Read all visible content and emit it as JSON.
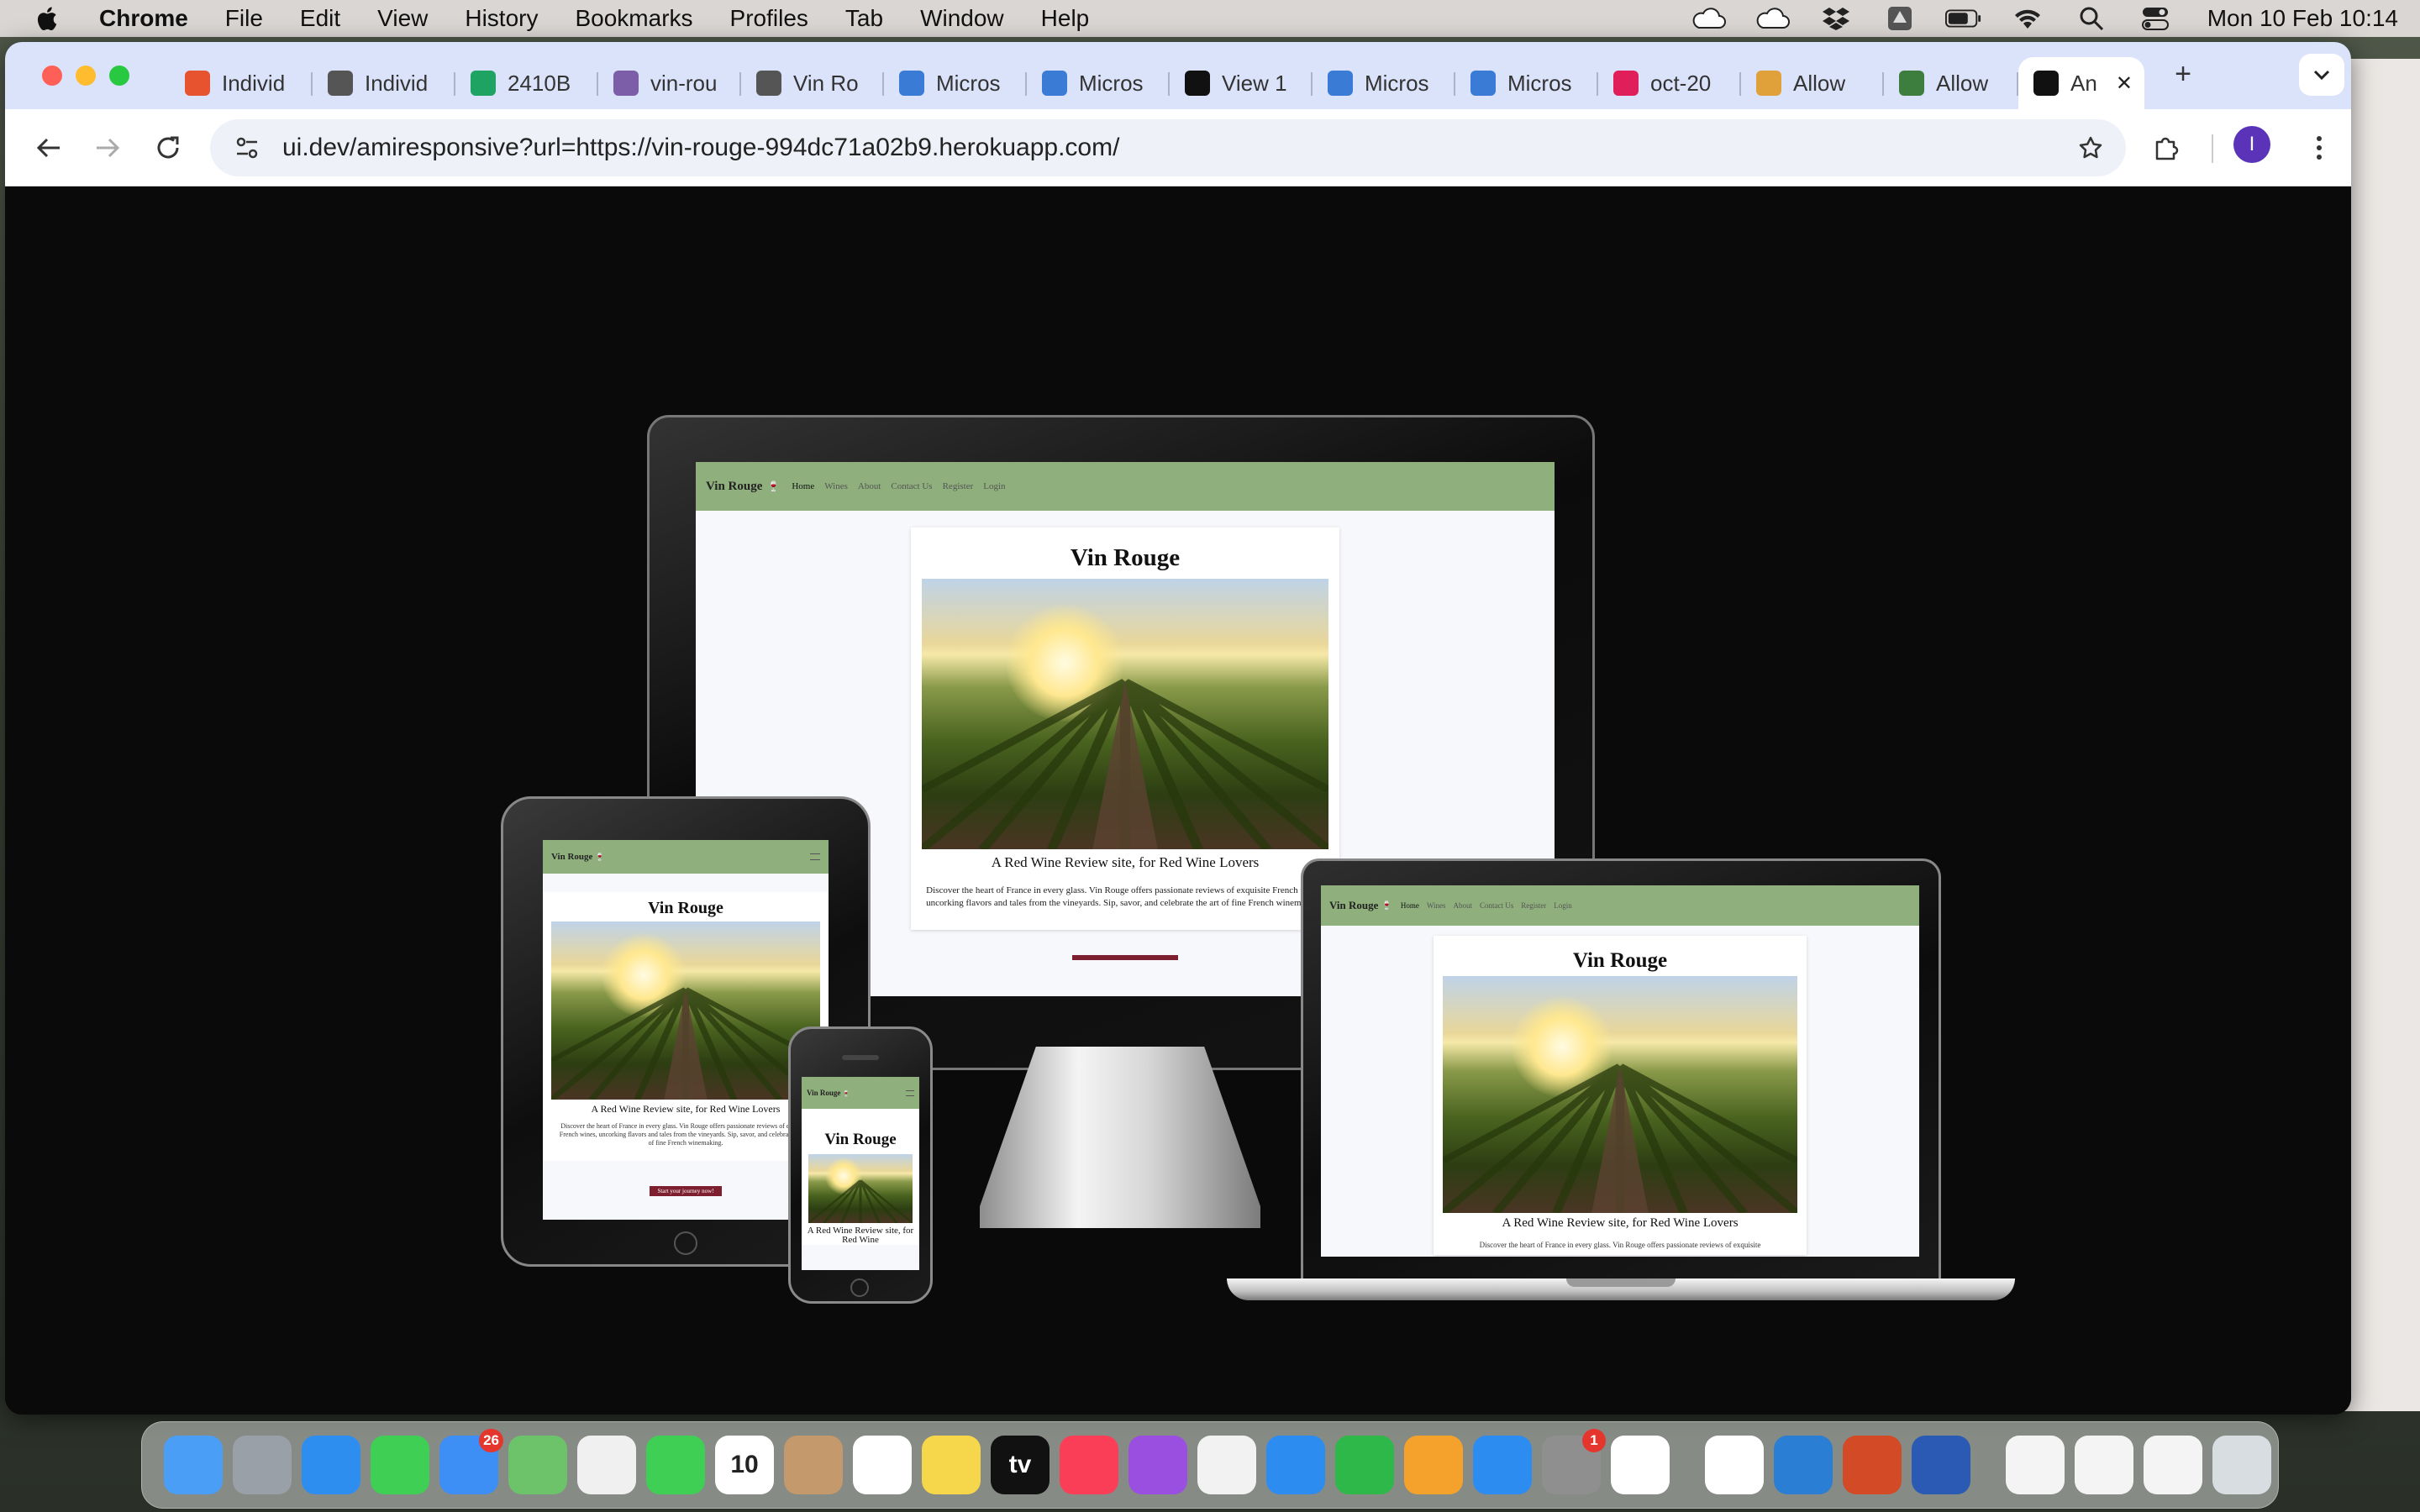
{
  "menubar": {
    "app": "Chrome",
    "items": [
      "File",
      "Edit",
      "View",
      "History",
      "Bookmarks",
      "Profiles",
      "Tab",
      "Window",
      "Help"
    ],
    "clock": "Mon 10 Feb  10:14"
  },
  "tabs": [
    {
      "label": "Individ",
      "icon": "opera-icon",
      "color": "#e8532f"
    },
    {
      "label": "Individ",
      "icon": "globe-icon",
      "color": "#555"
    },
    {
      "label": "2410B",
      "icon": "sheets-icon",
      "color": "#1ea362"
    },
    {
      "label": "vin-rou",
      "icon": "heroku-icon",
      "color": "#7b5ea7"
    },
    {
      "label": "Vin Ro",
      "icon": "globe-icon",
      "color": "#555"
    },
    {
      "label": "Micros",
      "icon": "copilot-icon",
      "color": "#3a7bd5"
    },
    {
      "label": "Micros",
      "icon": "copilot-icon",
      "color": "#3a7bd5"
    },
    {
      "label": "View 1",
      "icon": "github-icon",
      "color": "#111"
    },
    {
      "label": "Micros",
      "icon": "copilot-icon",
      "color": "#3a7bd5"
    },
    {
      "label": "Micros",
      "icon": "copilot-icon",
      "color": "#3a7bd5"
    },
    {
      "label": "oct-20",
      "icon": "slack-icon",
      "color": "#e01e5a"
    },
    {
      "label": "Allow",
      "icon": "rainbow-icon",
      "color": "#e0a13a"
    },
    {
      "label": "Allow",
      "icon": "page-icon",
      "color": "#3d7d3d"
    },
    {
      "label": "An",
      "icon": "ui-dev-icon",
      "color": "#111",
      "active": true
    }
  ],
  "address": {
    "url": "ui.dev/amiresponsive?url=https://vin-rouge-994dc71a02b9.herokuapp.com/"
  },
  "profile_initial": "I",
  "site": {
    "brand": "Vin Rouge",
    "nav": [
      "Home",
      "Wines",
      "About",
      "Contact Us",
      "Register",
      "Login"
    ],
    "title": "Vin Rouge",
    "tagline": "A Red Wine Review site, for Red Wine Lovers",
    "tagline_phone": "A Red Wine Review site, for Red Wine",
    "desc": "Discover the heart of France in every glass. Vin Rouge offers passionate reviews of exquisite French wines, uncorking flavors and tales from the vineyards. Sip, savor, and celebrate the art of fine French winemaking.",
    "desc_laptop": "Discover the heart of France in every glass. Vin Rouge offers passionate reviews of exquisite",
    "cta": "Start your journey now!"
  },
  "dock": {
    "icons": [
      {
        "name": "finder-icon",
        "color": "#4a9ef5"
      },
      {
        "name": "launchpad-icon",
        "color": "#9aa0a8"
      },
      {
        "name": "safari-icon",
        "color": "#2e8ef0"
      },
      {
        "name": "messages-icon",
        "color": "#3fcf55"
      },
      {
        "name": "mail-icon",
        "color": "#3d8ef5",
        "badge": "26"
      },
      {
        "name": "maps-icon",
        "color": "#6cc36a"
      },
      {
        "name": "photos-icon",
        "color": "#f0f0f0"
      },
      {
        "name": "facetime-icon",
        "color": "#3fcf55"
      },
      {
        "name": "calendar-icon",
        "color": "#ffffff",
        "text": "10"
      },
      {
        "name": "contacts-icon",
        "color": "#c49a6c"
      },
      {
        "name": "reminders-icon",
        "color": "#ffffff"
      },
      {
        "name": "notes-icon",
        "color": "#f6d64a"
      },
      {
        "name": "appletv-icon",
        "color": "#111111",
        "text": "tv"
      },
      {
        "name": "music-icon",
        "color": "#fa3e57"
      },
      {
        "name": "podcasts-icon",
        "color": "#9b4fe0"
      },
      {
        "name": "news-icon",
        "color": "#f2f2f2"
      },
      {
        "name": "keynote-icon",
        "color": "#2d8cf0"
      },
      {
        "name": "numbers-icon",
        "color": "#2fb84a"
      },
      {
        "name": "pages-icon",
        "color": "#f5a22d"
      },
      {
        "name": "appstore-icon",
        "color": "#2d8cf0"
      },
      {
        "name": "system-settings-icon",
        "color": "#8f8f8f",
        "badge": "1"
      },
      {
        "name": "chrome-icon",
        "color": "#ffffff"
      },
      {
        "name": "facemoji-icon",
        "color": "#ffffff"
      },
      {
        "name": "vscode-icon",
        "color": "#2a7fd4"
      },
      {
        "name": "powerpoint-icon",
        "color": "#d24b26"
      },
      {
        "name": "word-icon",
        "color": "#2b5ab5"
      },
      {
        "name": "recent-doc-1-icon",
        "color": "#f4f4f4"
      },
      {
        "name": "recent-doc-2-icon",
        "color": "#f4f4f4"
      },
      {
        "name": "recent-doc-3-icon",
        "color": "#f4f4f4"
      },
      {
        "name": "trash-icon",
        "color": "#d8dde2"
      }
    ]
  }
}
